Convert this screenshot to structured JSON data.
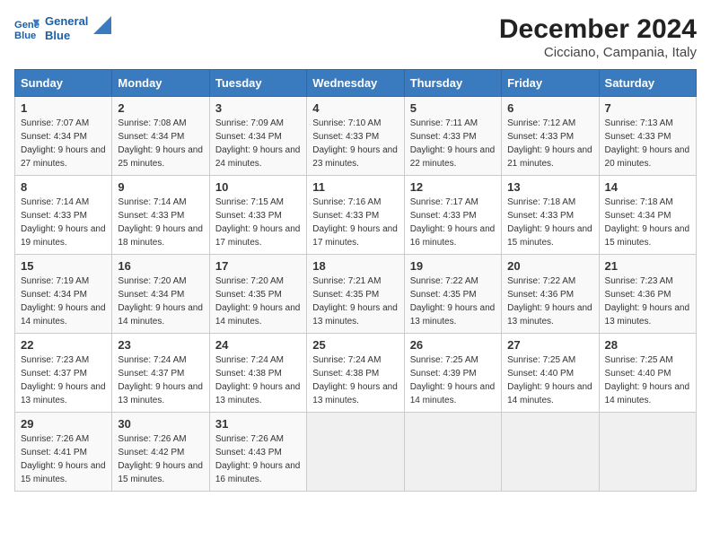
{
  "logo": {
    "line1": "General",
    "line2": "Blue"
  },
  "title": "December 2024",
  "subtitle": "Cicciano, Campania, Italy",
  "days_of_week": [
    "Sunday",
    "Monday",
    "Tuesday",
    "Wednesday",
    "Thursday",
    "Friday",
    "Saturday"
  ],
  "weeks": [
    [
      {
        "day": "1",
        "sunrise": "7:07 AM",
        "sunset": "4:34 PM",
        "daylight": "9 hours and 27 minutes."
      },
      {
        "day": "2",
        "sunrise": "7:08 AM",
        "sunset": "4:34 PM",
        "daylight": "9 hours and 25 minutes."
      },
      {
        "day": "3",
        "sunrise": "7:09 AM",
        "sunset": "4:34 PM",
        "daylight": "9 hours and 24 minutes."
      },
      {
        "day": "4",
        "sunrise": "7:10 AM",
        "sunset": "4:33 PM",
        "daylight": "9 hours and 23 minutes."
      },
      {
        "day": "5",
        "sunrise": "7:11 AM",
        "sunset": "4:33 PM",
        "daylight": "9 hours and 22 minutes."
      },
      {
        "day": "6",
        "sunrise": "7:12 AM",
        "sunset": "4:33 PM",
        "daylight": "9 hours and 21 minutes."
      },
      {
        "day": "7",
        "sunrise": "7:13 AM",
        "sunset": "4:33 PM",
        "daylight": "9 hours and 20 minutes."
      }
    ],
    [
      {
        "day": "8",
        "sunrise": "7:14 AM",
        "sunset": "4:33 PM",
        "daylight": "9 hours and 19 minutes."
      },
      {
        "day": "9",
        "sunrise": "7:14 AM",
        "sunset": "4:33 PM",
        "daylight": "9 hours and 18 minutes."
      },
      {
        "day": "10",
        "sunrise": "7:15 AM",
        "sunset": "4:33 PM",
        "daylight": "9 hours and 17 minutes."
      },
      {
        "day": "11",
        "sunrise": "7:16 AM",
        "sunset": "4:33 PM",
        "daylight": "9 hours and 17 minutes."
      },
      {
        "day": "12",
        "sunrise": "7:17 AM",
        "sunset": "4:33 PM",
        "daylight": "9 hours and 16 minutes."
      },
      {
        "day": "13",
        "sunrise": "7:18 AM",
        "sunset": "4:33 PM",
        "daylight": "9 hours and 15 minutes."
      },
      {
        "day": "14",
        "sunrise": "7:18 AM",
        "sunset": "4:34 PM",
        "daylight": "9 hours and 15 minutes."
      }
    ],
    [
      {
        "day": "15",
        "sunrise": "7:19 AM",
        "sunset": "4:34 PM",
        "daylight": "9 hours and 14 minutes."
      },
      {
        "day": "16",
        "sunrise": "7:20 AM",
        "sunset": "4:34 PM",
        "daylight": "9 hours and 14 minutes."
      },
      {
        "day": "17",
        "sunrise": "7:20 AM",
        "sunset": "4:35 PM",
        "daylight": "9 hours and 14 minutes."
      },
      {
        "day": "18",
        "sunrise": "7:21 AM",
        "sunset": "4:35 PM",
        "daylight": "9 hours and 13 minutes."
      },
      {
        "day": "19",
        "sunrise": "7:22 AM",
        "sunset": "4:35 PM",
        "daylight": "9 hours and 13 minutes."
      },
      {
        "day": "20",
        "sunrise": "7:22 AM",
        "sunset": "4:36 PM",
        "daylight": "9 hours and 13 minutes."
      },
      {
        "day": "21",
        "sunrise": "7:23 AM",
        "sunset": "4:36 PM",
        "daylight": "9 hours and 13 minutes."
      }
    ],
    [
      {
        "day": "22",
        "sunrise": "7:23 AM",
        "sunset": "4:37 PM",
        "daylight": "9 hours and 13 minutes."
      },
      {
        "day": "23",
        "sunrise": "7:24 AM",
        "sunset": "4:37 PM",
        "daylight": "9 hours and 13 minutes."
      },
      {
        "day": "24",
        "sunrise": "7:24 AM",
        "sunset": "4:38 PM",
        "daylight": "9 hours and 13 minutes."
      },
      {
        "day": "25",
        "sunrise": "7:24 AM",
        "sunset": "4:38 PM",
        "daylight": "9 hours and 13 minutes."
      },
      {
        "day": "26",
        "sunrise": "7:25 AM",
        "sunset": "4:39 PM",
        "daylight": "9 hours and 14 minutes."
      },
      {
        "day": "27",
        "sunrise": "7:25 AM",
        "sunset": "4:40 PM",
        "daylight": "9 hours and 14 minutes."
      },
      {
        "day": "28",
        "sunrise": "7:25 AM",
        "sunset": "4:40 PM",
        "daylight": "9 hours and 14 minutes."
      }
    ],
    [
      {
        "day": "29",
        "sunrise": "7:26 AM",
        "sunset": "4:41 PM",
        "daylight": "9 hours and 15 minutes."
      },
      {
        "day": "30",
        "sunrise": "7:26 AM",
        "sunset": "4:42 PM",
        "daylight": "9 hours and 15 minutes."
      },
      {
        "day": "31",
        "sunrise": "7:26 AM",
        "sunset": "4:43 PM",
        "daylight": "9 hours and 16 minutes."
      },
      null,
      null,
      null,
      null
    ]
  ],
  "labels": {
    "sunrise": "Sunrise:",
    "sunset": "Sunset:",
    "daylight": "Daylight:"
  }
}
